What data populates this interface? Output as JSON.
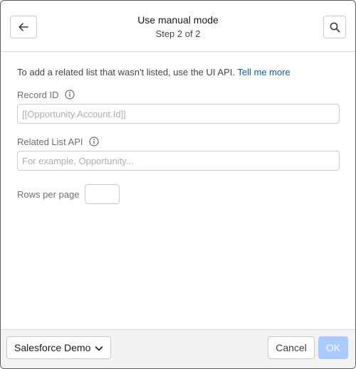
{
  "header": {
    "title": "Use manual mode",
    "subtitle": "Step 2 of 2",
    "back_icon": "arrow-left-icon",
    "search_icon": "search-icon"
  },
  "intro": {
    "text": "To add a related list that wasn't listed, use the UI API.",
    "link": "Tell me more"
  },
  "fields": {
    "record_id": {
      "label": "Record ID",
      "value": "",
      "placeholder": "[[Opportunity.Account.Id]]"
    },
    "related_list_api": {
      "label": "Related List API",
      "value": "",
      "placeholder": "For example, Opportunity..."
    },
    "rows_per_page": {
      "label": "Rows per page",
      "value": ""
    }
  },
  "footer": {
    "org_select": "Salesforce Demo",
    "cancel": "Cancel",
    "ok": "OK"
  },
  "colors": {
    "link": "#0b5cab",
    "ok_disabled": "#aacbff",
    "label": "#706e6b"
  }
}
